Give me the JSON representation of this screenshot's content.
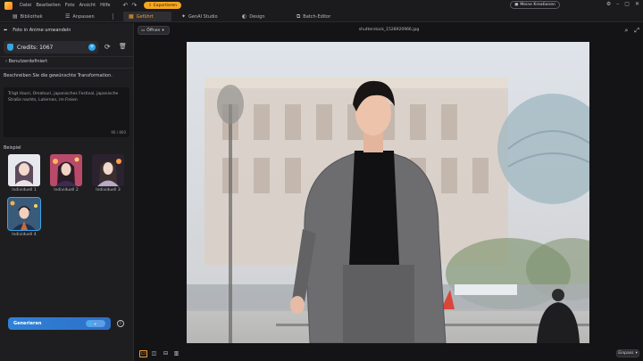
{
  "menu": [
    "Datei",
    "Bearbeiten",
    "Foto",
    "Ansicht",
    "Hilfe"
  ],
  "export_label": "Exportieren",
  "creations_label": "Meine Kreationen",
  "tabs": [
    {
      "label": "Bibliothek",
      "icon": "library-icon"
    },
    {
      "label": "Anpassen",
      "icon": "sliders-icon"
    },
    {
      "label": "Geführt",
      "icon": "guided-icon",
      "active": true
    },
    {
      "label": "GenAI Studio",
      "icon": "sparkle-icon"
    },
    {
      "label": "Design",
      "icon": "palette-icon"
    },
    {
      "label": "Batch-Editor",
      "icon": "batch-icon"
    }
  ],
  "panel": {
    "title": "Foto in Anime umwandeln",
    "credits": "Credits: 1067",
    "back_label": "Benutzerdefiniert",
    "describe_label": "Beschreiben Sie die gewünschte Transformation.",
    "prompt": "Trägt Haori, Omatsuri, japanisches Festival, japanische Straße nachts, Laternen, im Freien",
    "counter": "90 / 800",
    "example_label": "Beispiel",
    "examples": [
      "Individuell 1",
      "Individuell 2",
      "Individuell 3",
      "Individuell 4"
    ],
    "generate_label": "Generieren"
  },
  "canvas": {
    "open_label": "Öffnen",
    "filename": "shutterstock_1528920966.jpg",
    "fit_label": "Einpass"
  }
}
